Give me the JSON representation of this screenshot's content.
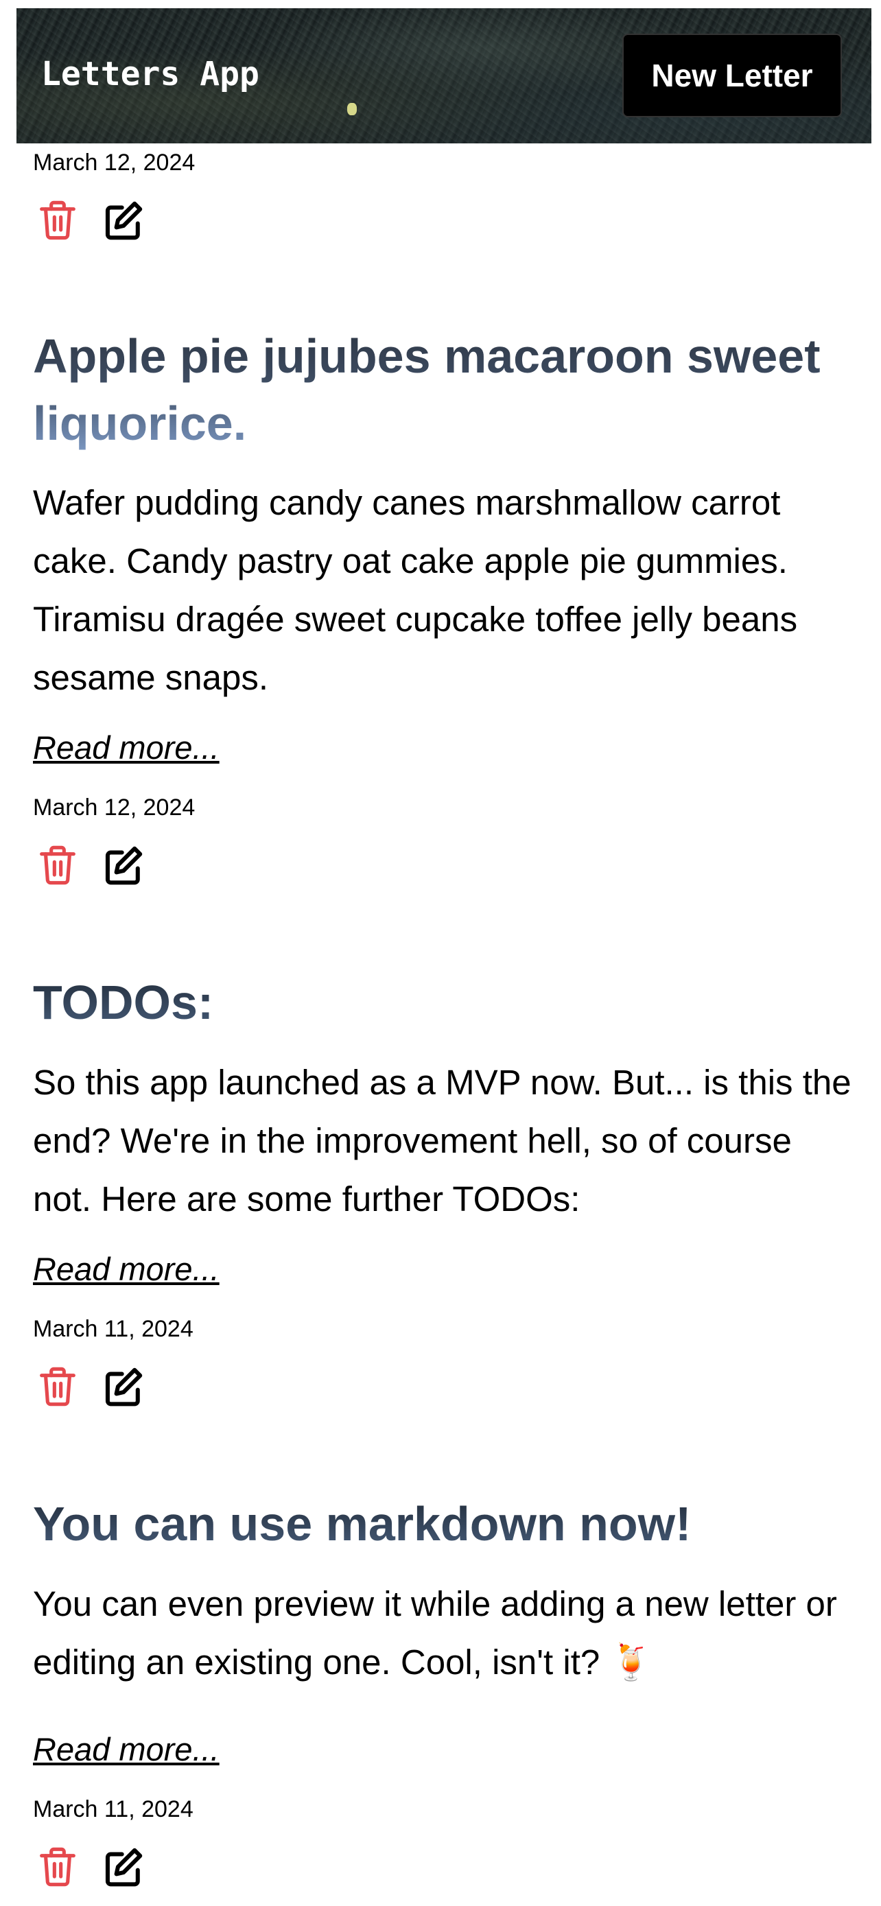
{
  "header": {
    "app_title": "Letters App",
    "new_letter_label": "New Letter"
  },
  "first_entry": {
    "date": "March 12, 2024"
  },
  "letters": [
    {
      "title": "Apple pie jujubes macaroon sweet liquorice.",
      "excerpt": "Wafer pudding candy canes marshmallow carrot cake. Candy pastry oat cake apple pie gummies. Tiramisu dragée sweet cupcake toffee jelly beans sesame snaps.",
      "read_more": "Read more...",
      "date": "March 12, 2024"
    },
    {
      "title": "TODOs:",
      "excerpt": "So this app launched as a MVP now. But... is this the end? We're in the improvement hell, so of course not. Here are some further TODOs:",
      "read_more": "Read more...",
      "date": "March 11, 2024"
    },
    {
      "title": "You can use markdown now!",
      "excerpt": "You can even preview it while adding a new letter or editing an existing one. Cool, isn't it? 🍹",
      "read_more": "Read more...",
      "date": "March 11, 2024"
    }
  ],
  "icons": {
    "delete": "trash-icon",
    "edit": "edit-icon"
  },
  "colors": {
    "delete_icon": "#e5484d",
    "title_dark": "#2c3441",
    "title_light": "#7f9cc8"
  }
}
